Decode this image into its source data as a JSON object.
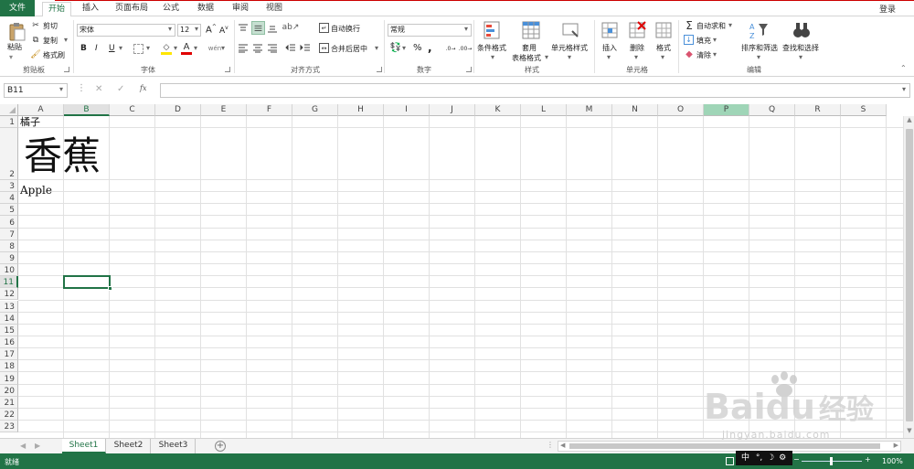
{
  "ribbon_tabs": {
    "file": "文件",
    "home": "开始",
    "insert": "插入",
    "page_layout": "页面布局",
    "formulas": "公式",
    "data": "数据",
    "review": "审阅",
    "view": "视图",
    "login": "登录"
  },
  "clipboard": {
    "paste": "粘贴",
    "cut": "剪切",
    "copy": "复制",
    "format_painter": "格式刷",
    "label": "剪贴板"
  },
  "font": {
    "name": "宋体",
    "size": "12",
    "bold": "B",
    "italic": "I",
    "underline": "U",
    "label": "字体"
  },
  "alignment": {
    "wrap_text": "自动换行",
    "merge_center": "合并后居中",
    "label": "对齐方式"
  },
  "number": {
    "format": "常规",
    "percent": "%",
    "comma": ",",
    "label": "数字"
  },
  "styles": {
    "conditional": "条件格式",
    "table_line1": "套用",
    "table_line2": "表格格式",
    "cell_styles": "单元格样式",
    "label": "样式"
  },
  "cells": {
    "insert": "插入",
    "delete": "删除",
    "format": "格式",
    "label": "单元格"
  },
  "editing": {
    "autosum": "自动求和",
    "fill": "填充",
    "clear": "清除",
    "sort_filter": "排序和筛选",
    "find_select": "查找和选择",
    "label": "编辑"
  },
  "formula_bar": {
    "name_box": "B11",
    "fx": "fx",
    "content": ""
  },
  "columns": [
    "A",
    "B",
    "C",
    "D",
    "E",
    "F",
    "G",
    "H",
    "I",
    "J",
    "K",
    "L",
    "M",
    "N",
    "O",
    "P",
    "Q",
    "R",
    "S"
  ],
  "rows": [
    "1",
    "2",
    "3",
    "4",
    "5",
    "6",
    "7",
    "8",
    "9",
    "10",
    "11",
    "12",
    "13",
    "14",
    "15",
    "16",
    "17",
    "18",
    "19",
    "20",
    "21",
    "22",
    "23"
  ],
  "cells_data": {
    "A1": "橘子",
    "A2": "香蕉",
    "A3": "Apple"
  },
  "sheets": [
    "Sheet1",
    "Sheet2",
    "Sheet3"
  ],
  "active_sheet": "Sheet1",
  "status": {
    "ready": "就绪",
    "zoom": "100%",
    "ime": "中"
  },
  "watermark": {
    "brand": "Bai",
    "brand2": "du",
    "brand_cn": "经验",
    "url": "jingyan.baidu.com"
  },
  "colors": {
    "accent": "#217346",
    "highlight_col": "#9fd5b7"
  }
}
